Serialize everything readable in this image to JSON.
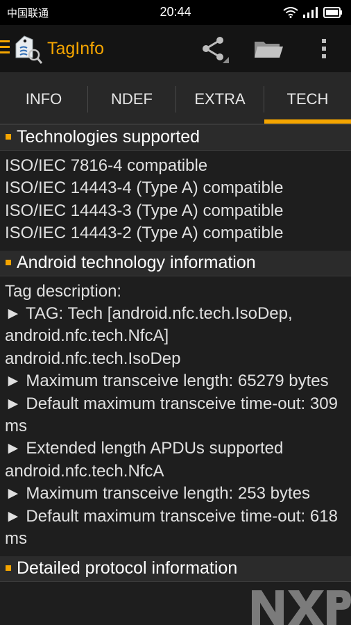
{
  "status_bar": {
    "carrier": "中国联通",
    "time": "20:44"
  },
  "action_bar": {
    "title": "TagInfo",
    "accent_color": "#f5a500",
    "icons": [
      "menu-icon",
      "app-logo-icon",
      "share-icon",
      "folder-icon",
      "overflow-menu-icon"
    ]
  },
  "tabs": [
    {
      "label": "INFO",
      "selected": false
    },
    {
      "label": "NDEF",
      "selected": false
    },
    {
      "label": "EXTRA",
      "selected": false
    },
    {
      "label": "TECH",
      "selected": true
    }
  ],
  "sections": {
    "technologies": {
      "title": "Technologies supported",
      "lines": [
        "ISO/IEC 7816-4 compatible",
        "ISO/IEC 14443-4 (Type A) compatible",
        "ISO/IEC 14443-3 (Type A) compatible",
        "ISO/IEC 14443-2 (Type A) compatible"
      ]
    },
    "android": {
      "title": "Android technology information",
      "lines": [
        "Tag description:",
        "► TAG: Tech [android.nfc.tech.IsoDep, android.nfc.tech.NfcA]",
        "android.nfc.tech.IsoDep",
        "► Maximum transceive length: 65279 bytes",
        "► Default maximum transceive time-out: 309 ms",
        "► Extended length APDUs supported",
        "android.nfc.tech.NfcA",
        "► Maximum transceive length: 253 bytes",
        "► Default maximum transceive time-out: 618 ms"
      ]
    },
    "protocol": {
      "title": "Detailed protocol information"
    }
  },
  "watermark": "NXP"
}
